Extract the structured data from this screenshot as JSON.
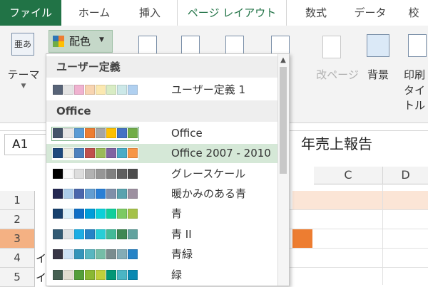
{
  "tabs": [
    "ファイル",
    "ホーム",
    "挿入",
    "ページ レイアウト",
    "数式",
    "データ",
    "校"
  ],
  "ribbon": {
    "theme_label": "テーマ",
    "colors_label": "配色",
    "page_break_label": "改ページ",
    "background_label": "背景",
    "print_titles_label_1": "印刷",
    "print_titles_label_2": "タイトル"
  },
  "formula_bar": {
    "name_box": "A1",
    "content": "年売上報告"
  },
  "grid": {
    "columns": [
      "C",
      "D"
    ],
    "rows": [
      "1",
      "2",
      "3",
      "4",
      "5"
    ],
    "cells": [
      "イ",
      "イ"
    ]
  },
  "menu": {
    "sections": [
      "ユーザー定義",
      "Office"
    ],
    "items": [
      {
        "label": "ユーザー定義 1",
        "swatches": [
          "#586478",
          "#e4e4e4",
          "#f0b2d0",
          "#f8d4b0",
          "#fbe8b0",
          "#d8ecc4",
          "#cce8e8",
          "#b0d0f0"
        ]
      },
      {
        "label": "Office",
        "swatches": [
          "#44546a",
          "#e7e6e6",
          "#5b9bd5",
          "#ed7d31",
          "#a5a5a5",
          "#ffc000",
          "#4472c4",
          "#70ad47"
        ]
      },
      {
        "label": "Office 2007 - 2010",
        "swatches": [
          "#1f497d",
          "#eeece1",
          "#4f81bd",
          "#c0504d",
          "#9bbb59",
          "#8064a2",
          "#4bacc6",
          "#f79646"
        ]
      },
      {
        "label": "グレースケール",
        "swatches": [
          "#000000",
          "#f8f8f8",
          "#dddddd",
          "#b2b2b2",
          "#969696",
          "#808080",
          "#5f5f5f",
          "#4d4d4d"
        ]
      },
      {
        "label": "暖かみのある青",
        "swatches": [
          "#242852",
          "#acccea",
          "#4a66ac",
          "#629dd1",
          "#297fd5",
          "#7f8fa9",
          "#5aa2ae",
          "#9d90a0"
        ]
      },
      {
        "label": "青",
        "swatches": [
          "#17406d",
          "#dbeff9",
          "#0f6fc6",
          "#009dd9",
          "#0bd0d9",
          "#10cf9b",
          "#7cca62",
          "#a5c249"
        ]
      },
      {
        "label": "青 II",
        "swatches": [
          "#335b74",
          "#dfe3e5",
          "#1cade4",
          "#2683c6",
          "#27ced7",
          "#42ba97",
          "#3e8853",
          "#62a39f"
        ]
      },
      {
        "label": "青緑",
        "swatches": [
          "#373545",
          "#cee2f6",
          "#3494ba",
          "#58b6c0",
          "#75bda7",
          "#7a8c8e",
          "#84acb6",
          "#2683c6"
        ]
      },
      {
        "label": "緑",
        "swatches": [
          "#455f51",
          "#e3ded1",
          "#549e39",
          "#8ab833",
          "#c0cf3a",
          "#029676",
          "#4ab5c4",
          "#0989b1"
        ]
      }
    ]
  }
}
